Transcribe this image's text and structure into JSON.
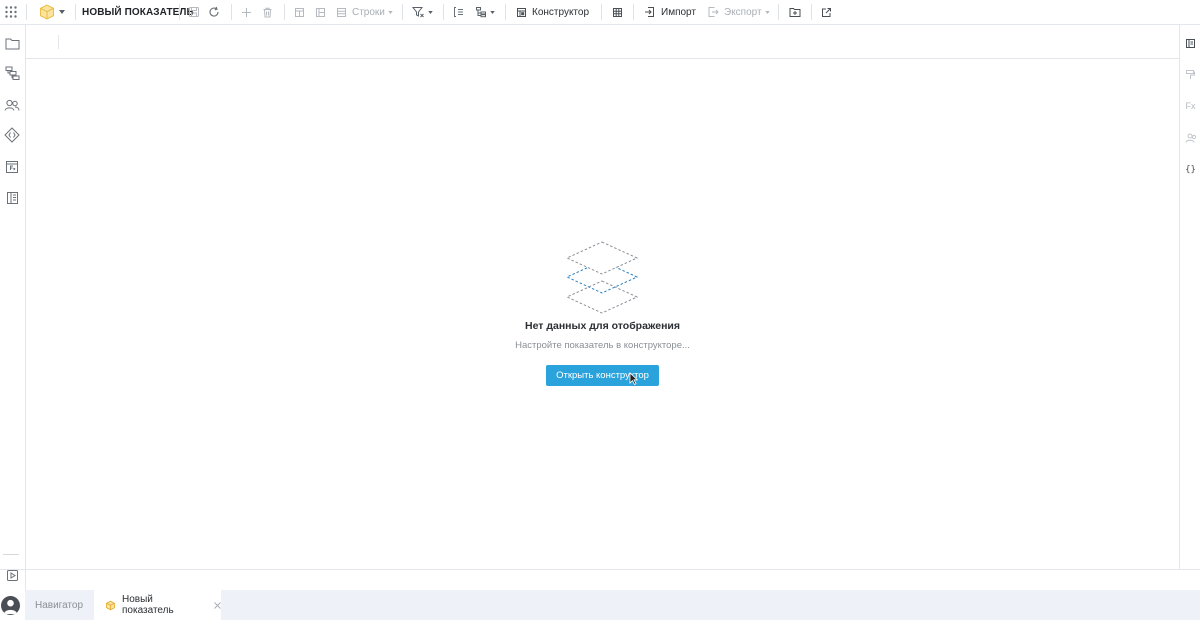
{
  "toolbar": {
    "doc_title": "НОВЫЙ ПОКАЗАТЕЛЬ",
    "rows_label": "Строки",
    "constructor_label": "Конструктор",
    "import_label": "Импорт",
    "export_label": "Экспорт"
  },
  "right_bar": {
    "fx_label": "Fx",
    "braces_label": "{}"
  },
  "main": {
    "empty_title": "Нет данных для отображения",
    "empty_hint": "Настройте показатель в конструкторе...",
    "open_button": "Открыть конструктор"
  },
  "tabs": [
    {
      "label": "Навигатор"
    },
    {
      "label": "Новый показатель"
    }
  ],
  "colors": {
    "accent": "#2aa3dc",
    "cube": "#f4c542",
    "empty_icon_active": "#2a7fbf",
    "empty_icon_idle": "#8a9097",
    "tab_bar": "#eef1f8"
  }
}
